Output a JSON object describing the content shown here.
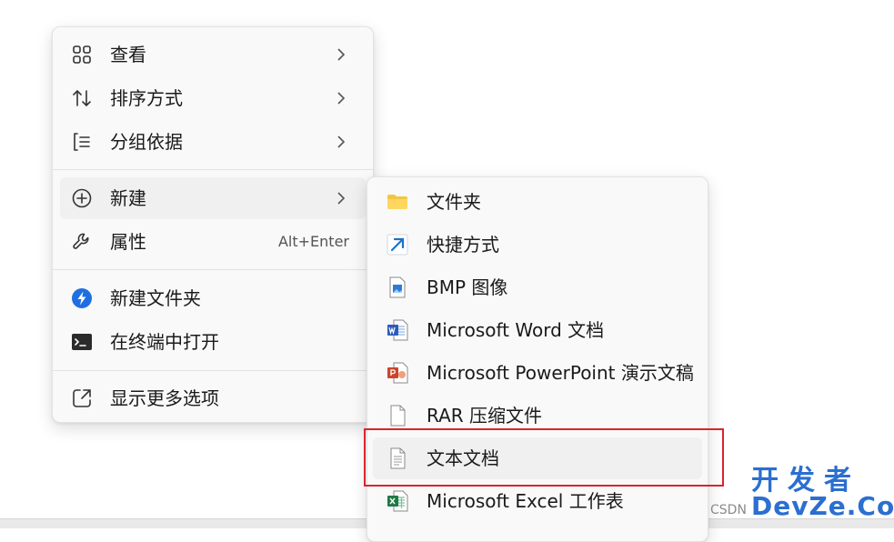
{
  "main_menu": {
    "items": [
      {
        "label": "查看",
        "icon": "grid-view-icon",
        "has_submenu": true
      },
      {
        "label": "排序方式",
        "icon": "sort-arrows-icon",
        "has_submenu": true
      },
      {
        "label": "分组依据",
        "icon": "group-list-icon",
        "has_submenu": true
      },
      {
        "label": "新建",
        "icon": "plus-circle-icon",
        "has_submenu": true,
        "hovered": true
      },
      {
        "label": "属性",
        "icon": "wrench-icon",
        "accelerator": "Alt+Enter"
      },
      {
        "label": "新建文件夹",
        "icon": "lightning-badge-icon"
      },
      {
        "label": "在终端中打开",
        "icon": "terminal-icon"
      },
      {
        "label": "显示更多选项",
        "icon": "external-link-icon"
      }
    ]
  },
  "new_submenu": {
    "items": [
      {
        "label": "文件夹",
        "icon": "folder-icon"
      },
      {
        "label": "快捷方式",
        "icon": "shortcut-arrow-icon"
      },
      {
        "label": "BMP 图像",
        "icon": "bmp-file-icon"
      },
      {
        "label": "Microsoft Word 文档",
        "icon": "word-file-icon"
      },
      {
        "label": "Microsoft PowerPoint 演示文稿",
        "icon": "powerpoint-file-icon"
      },
      {
        "label": "RAR 压缩文件",
        "icon": "blank-file-icon"
      },
      {
        "label": "文本文档",
        "icon": "text-file-icon",
        "highlighted": true
      },
      {
        "label": "Microsoft Excel 工作表",
        "icon": "excel-file-icon"
      }
    ]
  },
  "watermark": {
    "line1": "开发者",
    "line2": "DevZe.CoM",
    "csdn": "CSDN"
  },
  "colors": {
    "accent": "#0067c0",
    "highlight_box": "#d9252d",
    "watermark": "#2b6fd0"
  }
}
